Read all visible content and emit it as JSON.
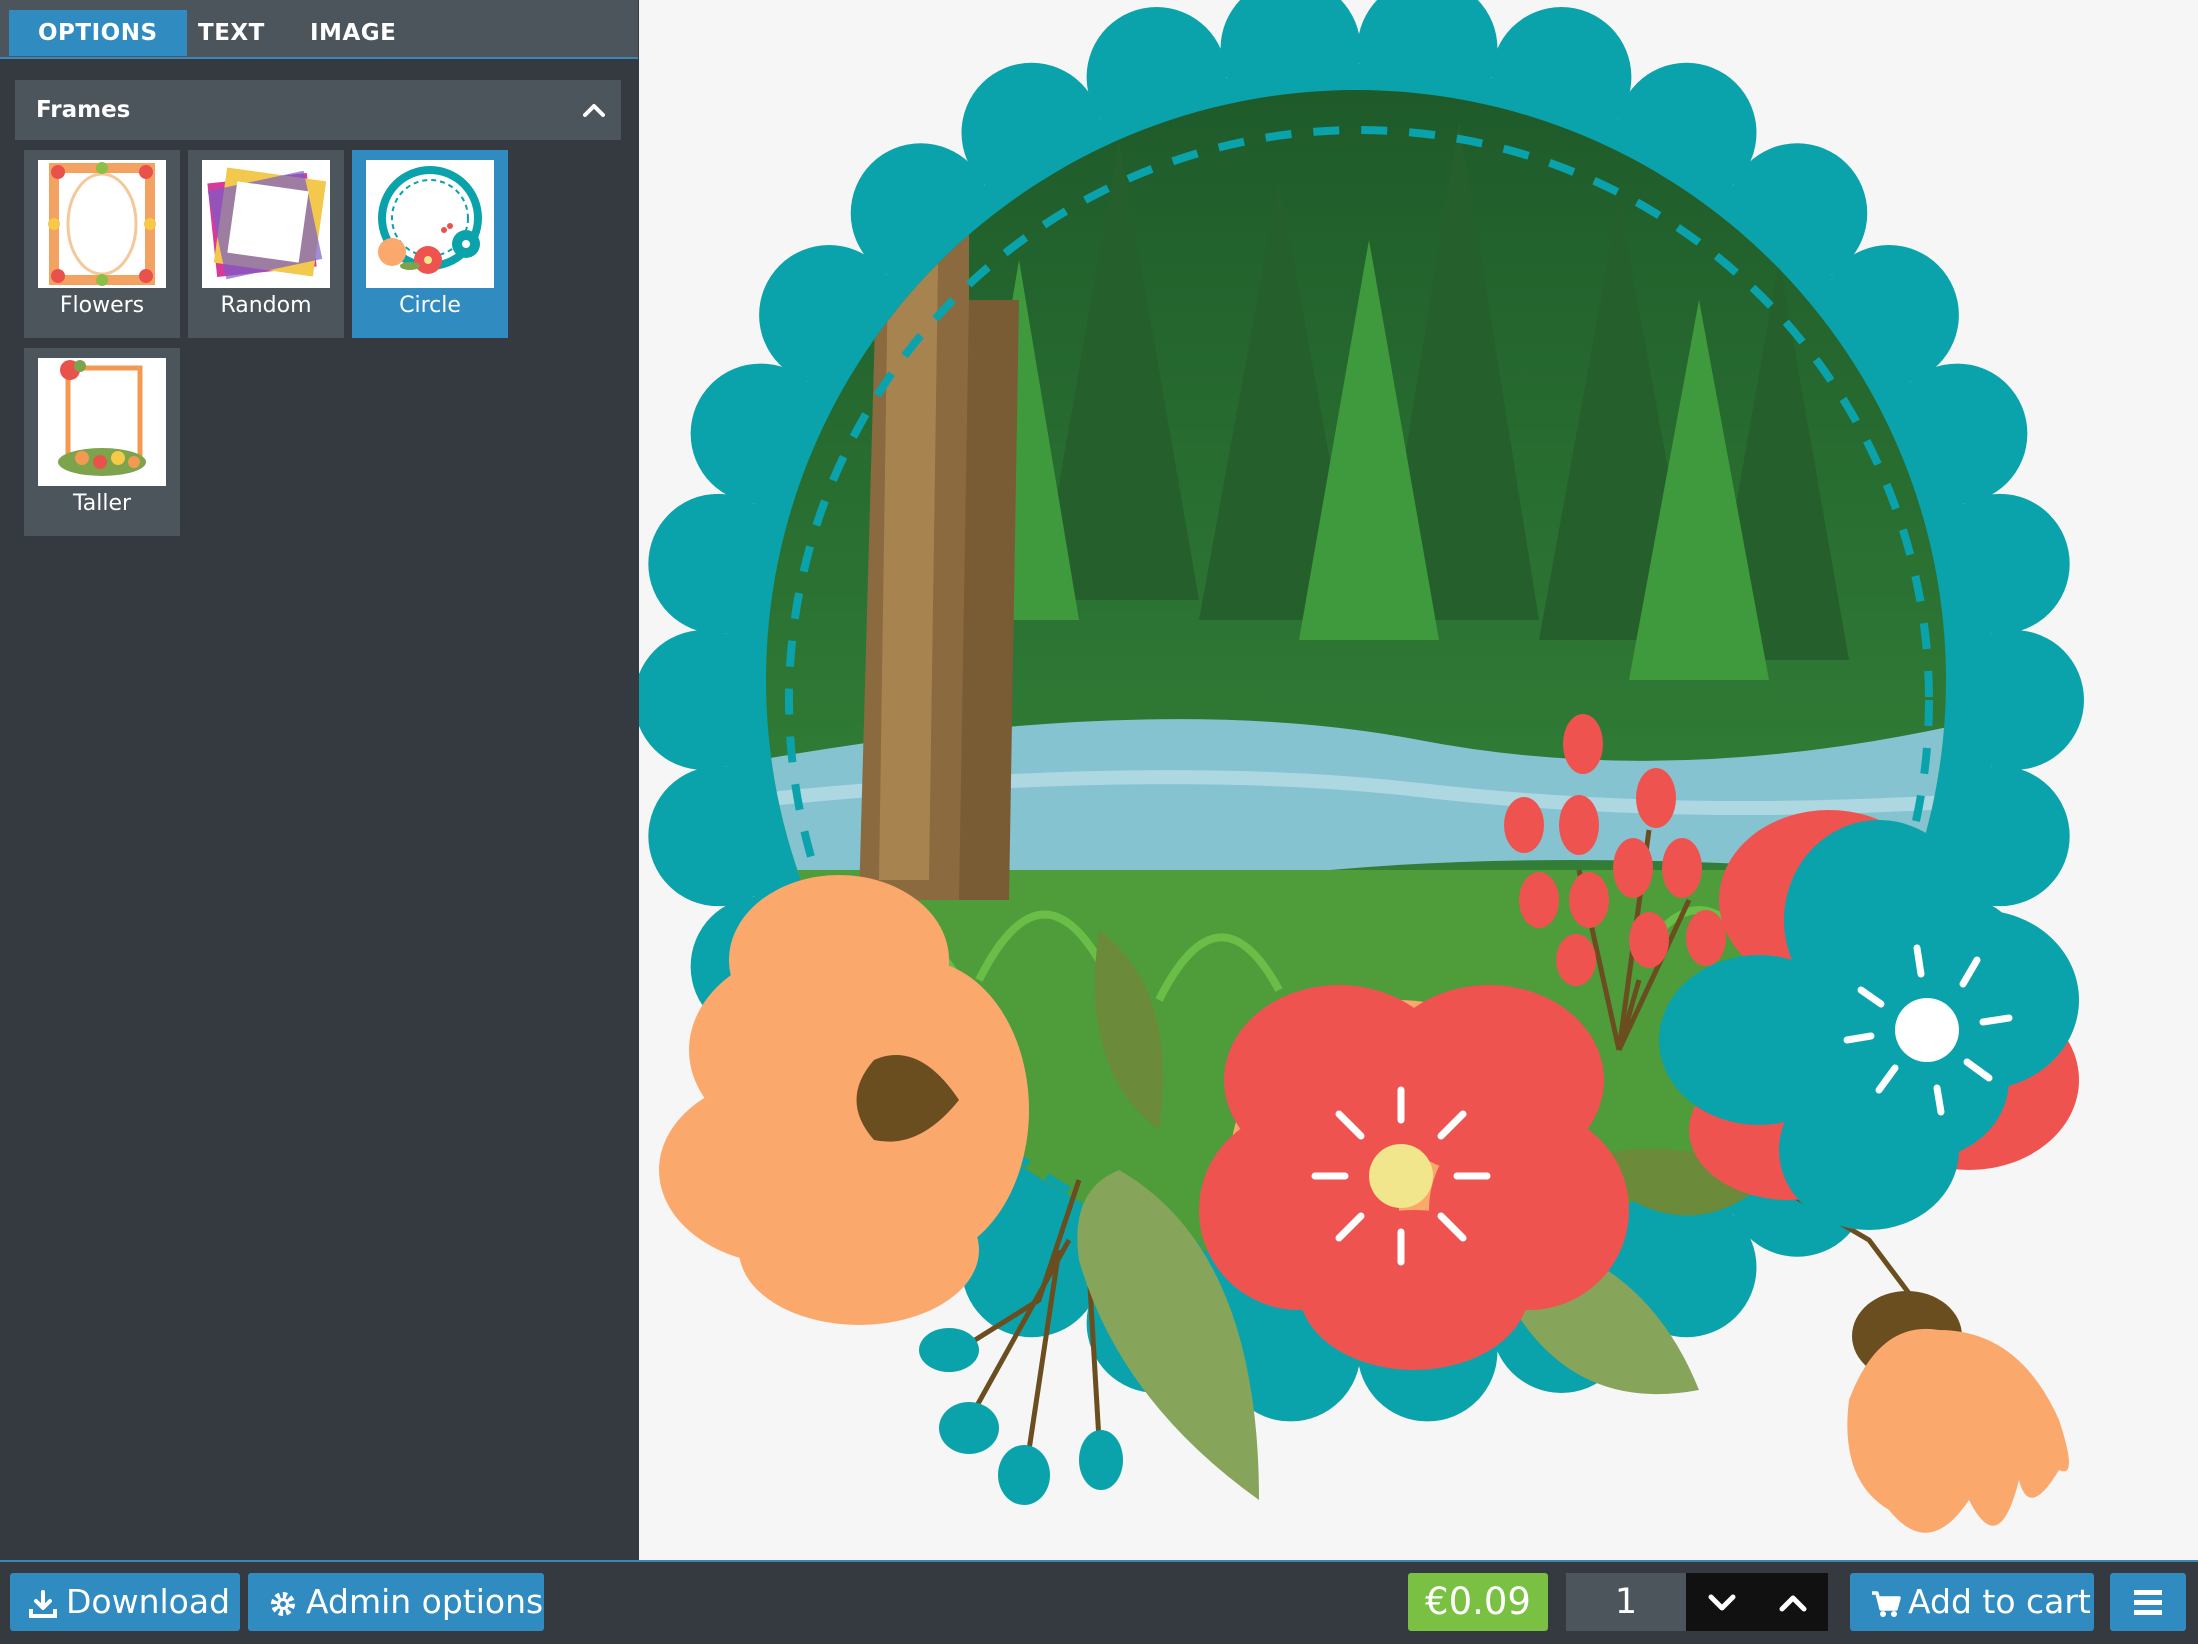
{
  "tabs": [
    {
      "label": "OPTIONS",
      "active": true
    },
    {
      "label": "TEXT",
      "active": false
    },
    {
      "label": "IMAGE",
      "active": false
    }
  ],
  "panel": {
    "title": "Frames",
    "collapse_icon": "chevron-up-icon"
  },
  "frames": [
    {
      "label": "Flowers",
      "selected": false
    },
    {
      "label": "Random",
      "selected": false
    },
    {
      "label": "Circle",
      "selected": true
    },
    {
      "label": "Taller",
      "selected": false
    }
  ],
  "toolbar": {
    "download_label": "Download",
    "download_icon": "download-icon",
    "admin_label": "Admin options",
    "admin_icon": "gear-icon",
    "price": "€0.09",
    "quantity": "1",
    "decrease_icon": "chevron-down-icon",
    "increase_icon": "chevron-up-icon",
    "cart_label": "Add to cart",
    "cart_icon": "cart-icon",
    "menu_icon": "hamburger-icon"
  },
  "colors": {
    "accent_blue": "#2f8bc0",
    "price_green": "#7ac143",
    "sidebar_bg": "#343a40",
    "frame_teal": "#0ba3ab",
    "flower_peach": "#fba86d",
    "flower_red": "#ef5350"
  }
}
